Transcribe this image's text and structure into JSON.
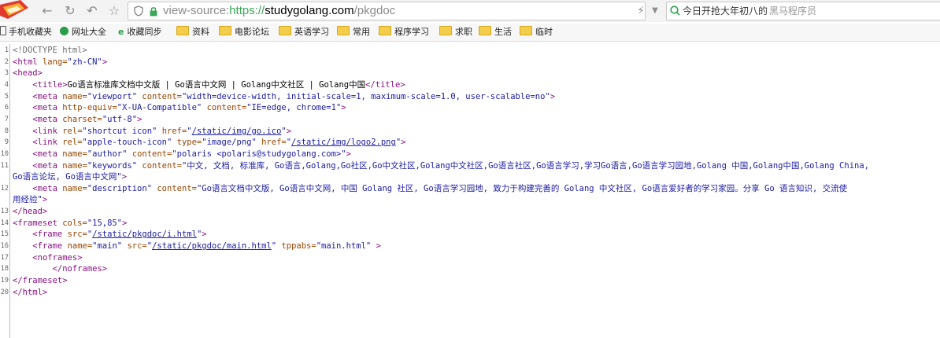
{
  "address": {
    "scheme": "view-source:",
    "url_https": "https://",
    "host": "studygolang.com",
    "path": "/pkgdoc"
  },
  "search": {
    "text": "今日开抢大年初八的",
    "overlay": "黑马程序员"
  },
  "bookmarks": [
    {
      "label": "手机收藏夹",
      "icon": "phone-icon"
    },
    {
      "label": "网址大全",
      "icon": "sites-icon"
    },
    {
      "label": "收藏同步",
      "icon": "sync-icon"
    },
    {
      "label": "资料",
      "icon": "folder-icon"
    },
    {
      "label": "电影论坛",
      "icon": "folder-icon"
    },
    {
      "label": "英语学习",
      "icon": "folder-icon"
    },
    {
      "label": "常用",
      "icon": "folder-icon"
    },
    {
      "label": "程序学习",
      "icon": "folder-icon"
    },
    {
      "label": "求职",
      "icon": "folder-icon"
    },
    {
      "label": "生活",
      "icon": "folder-icon"
    },
    {
      "label": "临时",
      "icon": "folder-icon"
    }
  ],
  "line_numbers": [
    "1",
    "2",
    "3",
    "4",
    "5",
    "6",
    "7",
    "8",
    "9",
    "10",
    "11",
    "",
    "12",
    "",
    "13",
    "14",
    "15",
    "16",
    "17",
    "18",
    "19",
    "20"
  ],
  "source_lines": [
    {
      "indent": "",
      "parts": [
        {
          "c": "c",
          "t": "<!DOCTYPE html>"
        }
      ]
    },
    {
      "indent": "",
      "parts": [
        {
          "c": "t",
          "t": "<html "
        },
        {
          "c": "a",
          "t": "lang="
        },
        {
          "c": "v",
          "t": "\"zh-CN\""
        },
        {
          "c": "t",
          "t": ">"
        }
      ]
    },
    {
      "indent": "",
      "parts": [
        {
          "c": "t",
          "t": "<head>"
        }
      ]
    },
    {
      "indent": "    ",
      "parts": [
        {
          "c": "t",
          "t": "<title>"
        },
        {
          "c": "x",
          "t": "Go语言标准库文档中文版 | Go语言中文网 | Golang中文社区 | Golang中国"
        },
        {
          "c": "t",
          "t": "</title>"
        }
      ]
    },
    {
      "indent": "    ",
      "parts": [
        {
          "c": "t",
          "t": "<meta "
        },
        {
          "c": "a",
          "t": "name="
        },
        {
          "c": "v",
          "t": "\"viewport\" "
        },
        {
          "c": "a",
          "t": "content="
        },
        {
          "c": "v",
          "t": "\"width=device-width, initial-scale=1, maximum-scale=1.0, user-scalable=no\""
        },
        {
          "c": "t",
          "t": ">"
        }
      ]
    },
    {
      "indent": "    ",
      "parts": [
        {
          "c": "t",
          "t": "<meta "
        },
        {
          "c": "a",
          "t": "http-equiv="
        },
        {
          "c": "v",
          "t": "\"X-UA-Compatible\" "
        },
        {
          "c": "a",
          "t": "content="
        },
        {
          "c": "v",
          "t": "\"IE=edge, chrome=1\""
        },
        {
          "c": "t",
          "t": ">"
        }
      ]
    },
    {
      "indent": "    ",
      "parts": [
        {
          "c": "t",
          "t": "<meta "
        },
        {
          "c": "a",
          "t": "charset="
        },
        {
          "c": "v",
          "t": "\"utf-8\""
        },
        {
          "c": "t",
          "t": ">"
        }
      ]
    },
    {
      "indent": "    ",
      "parts": [
        {
          "c": "t",
          "t": "<link "
        },
        {
          "c": "a",
          "t": "rel="
        },
        {
          "c": "v",
          "t": "\"shortcut icon\" "
        },
        {
          "c": "a",
          "t": "href="
        },
        {
          "c": "v",
          "t": "\""
        },
        {
          "c": "l",
          "t": "/static/img/go.ico"
        },
        {
          "c": "v",
          "t": "\""
        },
        {
          "c": "t",
          "t": ">"
        }
      ]
    },
    {
      "indent": "    ",
      "parts": [
        {
          "c": "t",
          "t": "<link "
        },
        {
          "c": "a",
          "t": "rel="
        },
        {
          "c": "v",
          "t": "\"apple-touch-icon\" "
        },
        {
          "c": "a",
          "t": "type="
        },
        {
          "c": "v",
          "t": "\"image/png\" "
        },
        {
          "c": "a",
          "t": "href="
        },
        {
          "c": "v",
          "t": "\""
        },
        {
          "c": "l",
          "t": "/static/img/logo2.png"
        },
        {
          "c": "v",
          "t": "\""
        },
        {
          "c": "t",
          "t": ">"
        }
      ]
    },
    {
      "indent": "    ",
      "parts": [
        {
          "c": "t",
          "t": "<meta "
        },
        {
          "c": "a",
          "t": "name="
        },
        {
          "c": "v",
          "t": "\"author\" "
        },
        {
          "c": "a",
          "t": "content="
        },
        {
          "c": "v",
          "t": "\"polaris <polaris@studygolang.com>\""
        },
        {
          "c": "t",
          "t": ">"
        }
      ]
    },
    {
      "indent": "    ",
      "parts": [
        {
          "c": "t",
          "t": "<meta "
        },
        {
          "c": "a",
          "t": "name="
        },
        {
          "c": "v",
          "t": "\"keywords\" "
        },
        {
          "c": "a",
          "t": "content="
        },
        {
          "c": "v",
          "t": "\"中文, 文档, 标准库, Go语言,Golang,Go社区,Go中文社区,Golang中文社区,Go语言社区,Go语言学习,学习Go语言,Go语言学习园地,Golang 中国,Golang中国,Golang China,"
        }
      ]
    },
    {
      "indent": "",
      "parts": [
        {
          "c": "v",
          "t": "Go语言论坛, Go语言中文网\""
        },
        {
          "c": "t",
          "t": ">"
        }
      ]
    },
    {
      "indent": "    ",
      "parts": [
        {
          "c": "t",
          "t": "<meta "
        },
        {
          "c": "a",
          "t": "name="
        },
        {
          "c": "v",
          "t": "\"description\" "
        },
        {
          "c": "a",
          "t": "content="
        },
        {
          "c": "v",
          "t": "\"Go语言文档中文版, Go语言中文网, 中国 Golang 社区, Go语言学习园地, 致力于构建完善的 Golang 中文社区, Go语言爱好者的学习家园。分享 Go 语言知识, 交流使"
        }
      ]
    },
    {
      "indent": "",
      "parts": [
        {
          "c": "v",
          "t": "用经验\""
        },
        {
          "c": "t",
          "t": ">"
        }
      ]
    },
    {
      "indent": "",
      "parts": [
        {
          "c": "t",
          "t": "</head>"
        }
      ]
    },
    {
      "indent": "",
      "parts": [
        {
          "c": "t",
          "t": "<frameset "
        },
        {
          "c": "a",
          "t": "cols="
        },
        {
          "c": "v",
          "t": "\"15,85\""
        },
        {
          "c": "t",
          "t": ">"
        }
      ]
    },
    {
      "indent": "    ",
      "parts": [
        {
          "c": "t",
          "t": "<frame "
        },
        {
          "c": "a",
          "t": "src="
        },
        {
          "c": "v",
          "t": "\""
        },
        {
          "c": "l",
          "t": "/static/pkgdoc/i.html"
        },
        {
          "c": "v",
          "t": "\""
        },
        {
          "c": "t",
          "t": ">"
        }
      ]
    },
    {
      "indent": "    ",
      "parts": [
        {
          "c": "t",
          "t": "<frame "
        },
        {
          "c": "a",
          "t": "name="
        },
        {
          "c": "v",
          "t": "\"main\" "
        },
        {
          "c": "a",
          "t": "src="
        },
        {
          "c": "v",
          "t": "\""
        },
        {
          "c": "l",
          "t": "/static/pkgdoc/main.html"
        },
        {
          "c": "v",
          "t": "\" "
        },
        {
          "c": "a",
          "t": "tppabs="
        },
        {
          "c": "v",
          "t": "\"main.html\" "
        },
        {
          "c": "t",
          "t": ">"
        }
      ]
    },
    {
      "indent": "    ",
      "parts": [
        {
          "c": "t",
          "t": "<noframes>"
        }
      ]
    },
    {
      "indent": "        ",
      "parts": [
        {
          "c": "t",
          "t": "</noframes>"
        }
      ]
    },
    {
      "indent": "",
      "parts": [
        {
          "c": "t",
          "t": "</frameset>"
        }
      ]
    },
    {
      "indent": "",
      "parts": [
        {
          "c": "t",
          "t": "</html>"
        }
      ]
    }
  ]
}
